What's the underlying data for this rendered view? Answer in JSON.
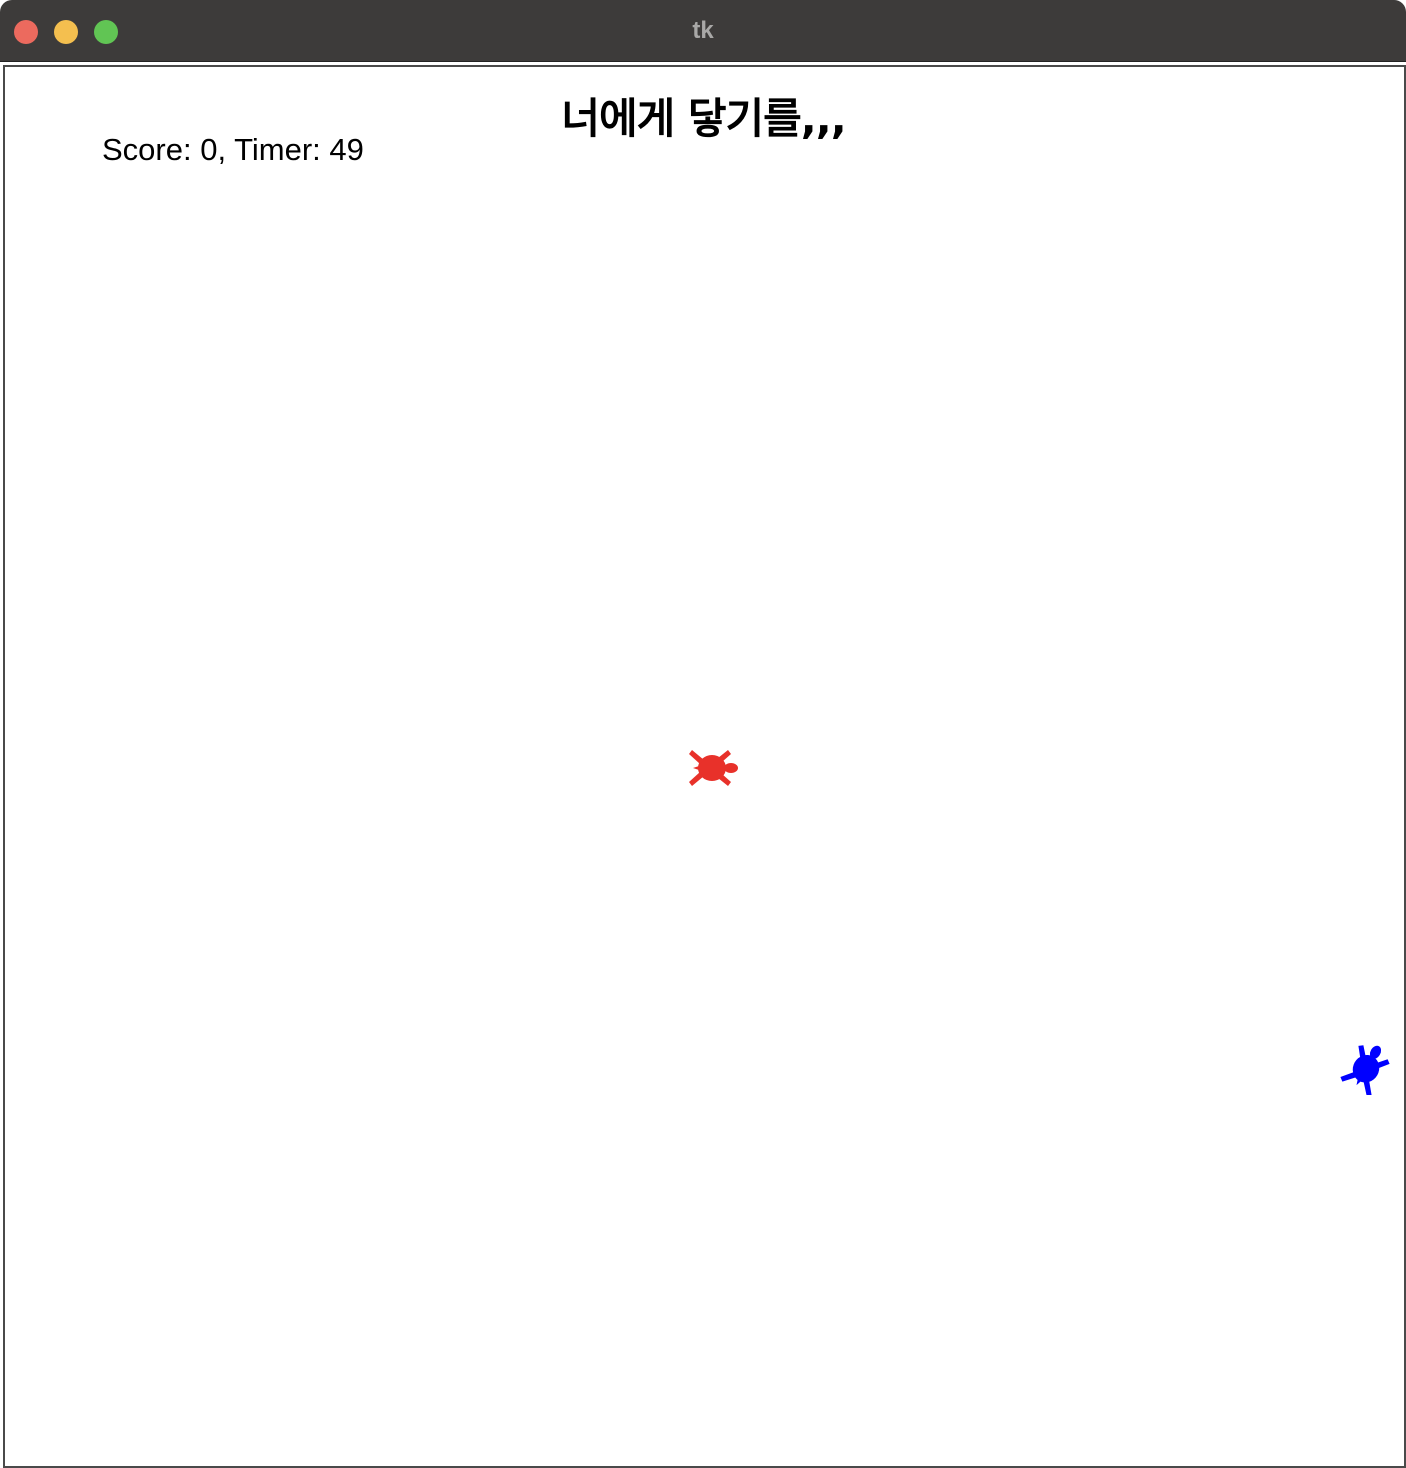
{
  "window": {
    "title": "tk"
  },
  "game": {
    "title": "너에게 닿기를,,,",
    "status_text": "Score: 0, Timer: 49",
    "score": 0,
    "timer": 49
  },
  "sprites": {
    "player": {
      "icon": "turtle-icon",
      "color": "#e8312a",
      "heading": "east"
    },
    "target": {
      "icon": "turtle-icon",
      "color": "#0000ff",
      "heading": "north"
    }
  },
  "colors": {
    "titlebar": "#3d3b3a",
    "canvas_bg": "#ffffff",
    "close": "#ec6a5e",
    "minimize": "#f4bf4f",
    "maximize": "#61c554"
  }
}
